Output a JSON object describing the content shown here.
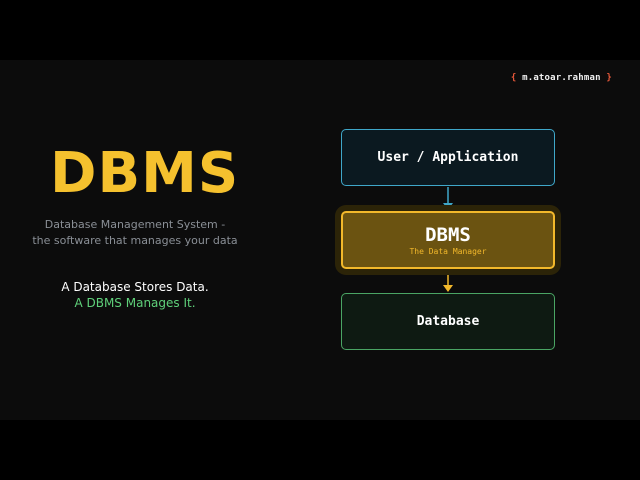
{
  "handle": {
    "open": "{",
    "name": "m.atoar.rahman",
    "close": "}"
  },
  "title": "DBMS",
  "subtitle_line1": "Database Management System -",
  "subtitle_line2": "the software that manages your data",
  "tagline1": "A Database Stores Data.",
  "tagline2": "A DBMS Manages It.",
  "diagram": {
    "top_box": "User / Application",
    "middle_box": {
      "label": "DBMS",
      "sublabel": "The Data Manager"
    },
    "bottom_box": "Database"
  },
  "colors": {
    "title": "#f5c12e",
    "user_border": "#3fa7c9",
    "dbms_border": "#f2b82b",
    "db_border": "#4aa564",
    "tagline2": "#5fd07a"
  }
}
